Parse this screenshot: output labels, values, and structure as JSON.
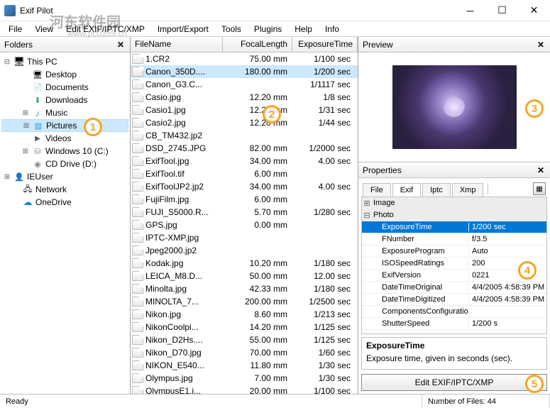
{
  "window": {
    "title": "Exif Pilot"
  },
  "menu": [
    "File",
    "View",
    "Edit EXIF/IPTC/XMP",
    "Import/Export",
    "Tools",
    "Plugins",
    "Help",
    "Info"
  ],
  "folders": {
    "header": "Folders",
    "tree": [
      {
        "exp": "⊟",
        "icon": "ic-monitor",
        "label": "This PC",
        "lvl": 0
      },
      {
        "exp": "",
        "icon": "ic-desktop",
        "label": "Desktop",
        "lvl": 2
      },
      {
        "exp": "",
        "icon": "ic-folder",
        "label": "Documents",
        "lvl": 2
      },
      {
        "exp": "",
        "icon": "ic-dl",
        "label": "Downloads",
        "lvl": 2
      },
      {
        "exp": "⊞",
        "icon": "ic-music",
        "label": "Music",
        "lvl": 2
      },
      {
        "exp": "⊞",
        "icon": "ic-pic",
        "label": "Pictures",
        "lvl": 2,
        "sel": true
      },
      {
        "exp": "",
        "icon": "ic-video",
        "label": "Videos",
        "lvl": 2
      },
      {
        "exp": "⊞",
        "icon": "ic-drive",
        "label": "Windows 10 (C:)",
        "lvl": 2
      },
      {
        "exp": "",
        "icon": "ic-cd",
        "label": "CD Drive (D:)",
        "lvl": 2
      },
      {
        "exp": "⊞",
        "icon": "ic-user",
        "label": "IEUser",
        "lvl": 0
      },
      {
        "exp": "",
        "icon": "ic-net",
        "label": "Network",
        "lvl": 1
      },
      {
        "exp": "",
        "icon": "ic-cloud",
        "label": "OneDrive",
        "lvl": 1
      }
    ]
  },
  "filelist": {
    "cols": [
      "FileName",
      "FocalLength",
      "ExposureTime"
    ],
    "rows": [
      {
        "n": "1.CR2",
        "f": "75.00 mm",
        "e": "1/100 sec"
      },
      {
        "n": "Canon_350D....",
        "f": "180.00 mm",
        "e": "1/200 sec",
        "sel": true
      },
      {
        "n": "Canon_G3.C...",
        "f": "",
        "e": "1/1117 sec"
      },
      {
        "n": "Casio.jpg",
        "f": "12.20 mm",
        "e": "1/8 sec"
      },
      {
        "n": "Casio1.jpg",
        "f": "12.20 mm",
        "e": "1/31 sec"
      },
      {
        "n": "Casio2.jpg",
        "f": "12.20 mm",
        "e": "1/44 sec"
      },
      {
        "n": "CB_TM432.jp2",
        "f": "",
        "e": ""
      },
      {
        "n": "DSD_2745.JPG",
        "f": "82.00 mm",
        "e": "1/2000 sec"
      },
      {
        "n": "ExifTool.jpg",
        "f": "34.00 mm",
        "e": "4.00 sec"
      },
      {
        "n": "ExifTool.tif",
        "f": "6.00 mm",
        "e": ""
      },
      {
        "n": "ExifToolJP2.jp2",
        "f": "34.00 mm",
        "e": "4.00 sec"
      },
      {
        "n": "FujiFilm.jpg",
        "f": "6.00 mm",
        "e": ""
      },
      {
        "n": "FUJI_S5000.R...",
        "f": "5.70 mm",
        "e": "1/280 sec"
      },
      {
        "n": "GPS.jpg",
        "f": "0.00 mm",
        "e": ""
      },
      {
        "n": "IPTC-XMP.jpg",
        "f": "",
        "e": ""
      },
      {
        "n": "Jpeg2000.jp2",
        "f": "",
        "e": ""
      },
      {
        "n": "Kodak.jpg",
        "f": "10.20 mm",
        "e": "1/180 sec"
      },
      {
        "n": "LEICA_M8.D...",
        "f": "50.00 mm",
        "e": "12.00 sec"
      },
      {
        "n": "Minolta.jpg",
        "f": "42.33 mm",
        "e": "1/180 sec"
      },
      {
        "n": "MINOLTA_7...",
        "f": "200.00 mm",
        "e": "1/2500 sec"
      },
      {
        "n": "Nikon.jpg",
        "f": "8.60 mm",
        "e": "1/213 sec"
      },
      {
        "n": "NikonCoolpi...",
        "f": "14.20 mm",
        "e": "1/125 sec"
      },
      {
        "n": "Nikon_D2Hs....",
        "f": "55.00 mm",
        "e": "1/125 sec"
      },
      {
        "n": "Nikon_D70.jpg",
        "f": "70.00 mm",
        "e": "1/60 sec"
      },
      {
        "n": "NIKON_E540...",
        "f": "11.80 mm",
        "e": "1/30 sec"
      },
      {
        "n": "Olympus.jpg",
        "f": "7.00 mm",
        "e": "1/30 sec"
      },
      {
        "n": "OlympusE1.j...",
        "f": "20.00 mm",
        "e": "1/100 sec"
      }
    ]
  },
  "preview": {
    "header": "Preview"
  },
  "properties": {
    "header": "Properties",
    "tabs": [
      "File",
      "Exif",
      "Iptc",
      "Xmp"
    ],
    "active_tab": "Exif",
    "rows": [
      {
        "exp": "⊞",
        "name": "Image",
        "group": true
      },
      {
        "exp": "⊟",
        "name": "Photo",
        "group": true
      },
      {
        "name": "ExposureTime",
        "val": "1/200 sec",
        "sub": true,
        "sel": true
      },
      {
        "name": "FNumber",
        "val": "f/3.5",
        "sub": true
      },
      {
        "name": "ExposureProgram",
        "val": "Auto",
        "sub": true
      },
      {
        "name": "ISOSpeedRatings",
        "val": "200",
        "sub": true
      },
      {
        "name": "ExifVersion",
        "val": "0221",
        "sub": true
      },
      {
        "name": "DateTimeOriginal",
        "val": "4/4/2005 4:58:39 PM",
        "sub": true
      },
      {
        "name": "DateTimeDigitized",
        "val": "4/4/2005 4:58:39 PM",
        "sub": true
      },
      {
        "name": "ComponentsConfiguration",
        "val": "",
        "sub": true
      },
      {
        "name": "ShutterSpeed",
        "val": "1/200 s",
        "sub": true
      }
    ],
    "desc_title": "ExposureTime",
    "desc_text": "Exposure time, given in seconds (sec).",
    "edit_button": "Edit EXIF/IPTC/XMP"
  },
  "status": {
    "left": "Ready",
    "right": "Number of Files: 44"
  },
  "badges": [
    "1",
    "2",
    "3",
    "4",
    "5"
  ],
  "watermark": "河东软件园",
  "watermark_url": "www.pc0359.cn"
}
